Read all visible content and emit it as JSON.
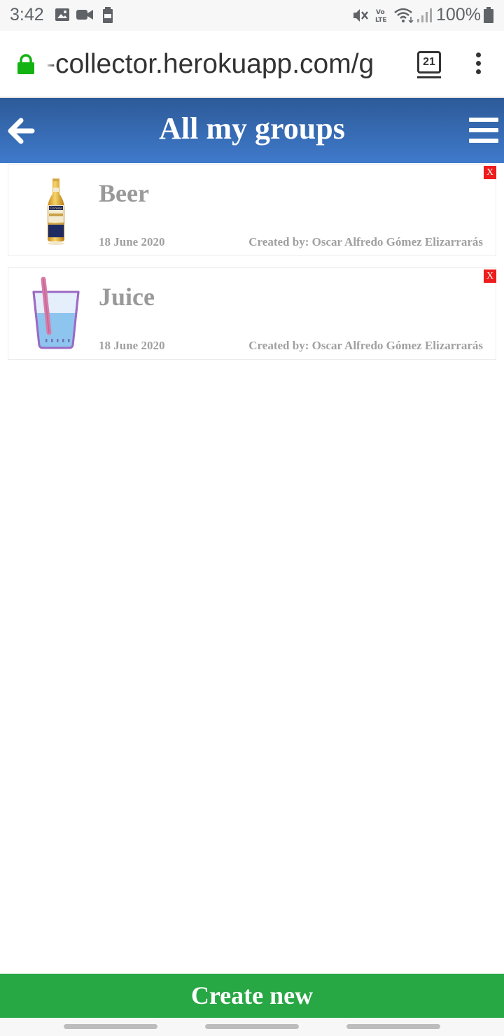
{
  "status_bar": {
    "time": "3:42",
    "battery_percent": "100%",
    "notification_icons": [
      "image-icon",
      "video-camera-icon",
      "battery-saver-icon"
    ],
    "system_icons": [
      "mute-icon",
      "volte-icon",
      "wifi-icon",
      "signal-icon",
      "battery-icon"
    ]
  },
  "browser": {
    "url": "-collector.herokuapp.com/g",
    "tab_count": "21",
    "lock_color": "#12b312"
  },
  "header": {
    "title": "All my groups",
    "gradient_top": "#2d5a98",
    "gradient_bottom": "#3f7acb"
  },
  "groups": [
    {
      "name": "Beer",
      "date": "18 June 2020",
      "creator": "Created by: Oscar Alfredo Gómez Elizarrarás",
      "delete_label": "X",
      "icon": "beer-bottle-icon"
    },
    {
      "name": "Juice",
      "date": "18 June 2020",
      "creator": "Created by: Oscar Alfredo Gómez Elizarrarás",
      "delete_label": "X",
      "icon": "juice-glass-icon"
    }
  ],
  "footer": {
    "create_label": "Create new",
    "create_color": "#28a745"
  }
}
